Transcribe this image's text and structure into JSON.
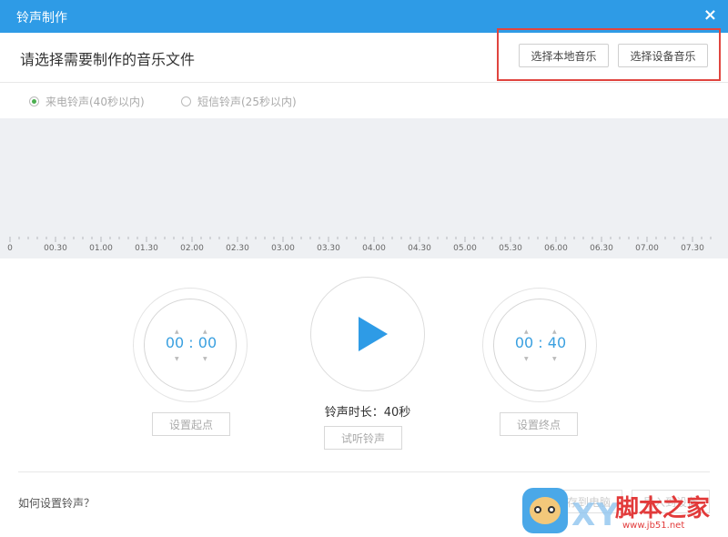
{
  "window": {
    "title": "铃声制作",
    "close_icon": "×"
  },
  "header": {
    "heading": "请选择需要制作的音乐文件",
    "btn_local": "选择本地音乐",
    "btn_device": "选择设备音乐",
    "highlight_color": "#e0453f"
  },
  "ringtype": {
    "call_label": "来电铃声(40秒以内)",
    "sms_label": "短信铃声(25秒以内)",
    "selected": "call"
  },
  "timeline": {
    "labels": [
      "0",
      "00.30",
      "01.00",
      "01.30",
      "02.00",
      "02.30",
      "03.00",
      "03.30",
      "04.00",
      "04.30",
      "05.00",
      "05.30",
      "06.00",
      "06.30",
      "07.00",
      "07.30"
    ]
  },
  "start": {
    "time": "00 : 00",
    "button": "设置起点"
  },
  "end": {
    "time": "00 : 40",
    "button": "设置终点"
  },
  "player": {
    "duration": "铃声时长：40秒",
    "preview_button": "试听铃声"
  },
  "footer": {
    "help_link": "如何设置铃声？",
    "save_pc": "保存到电脑",
    "import_device": "导入到设备"
  },
  "watermark": {
    "brand": "XY",
    "site": "脚本之家",
    "url": "www.jb51.net"
  },
  "colors": {
    "titlebar": "#2e9be6",
    "accent": "#3aa0e0",
    "radio_dot": "#4caf50"
  }
}
